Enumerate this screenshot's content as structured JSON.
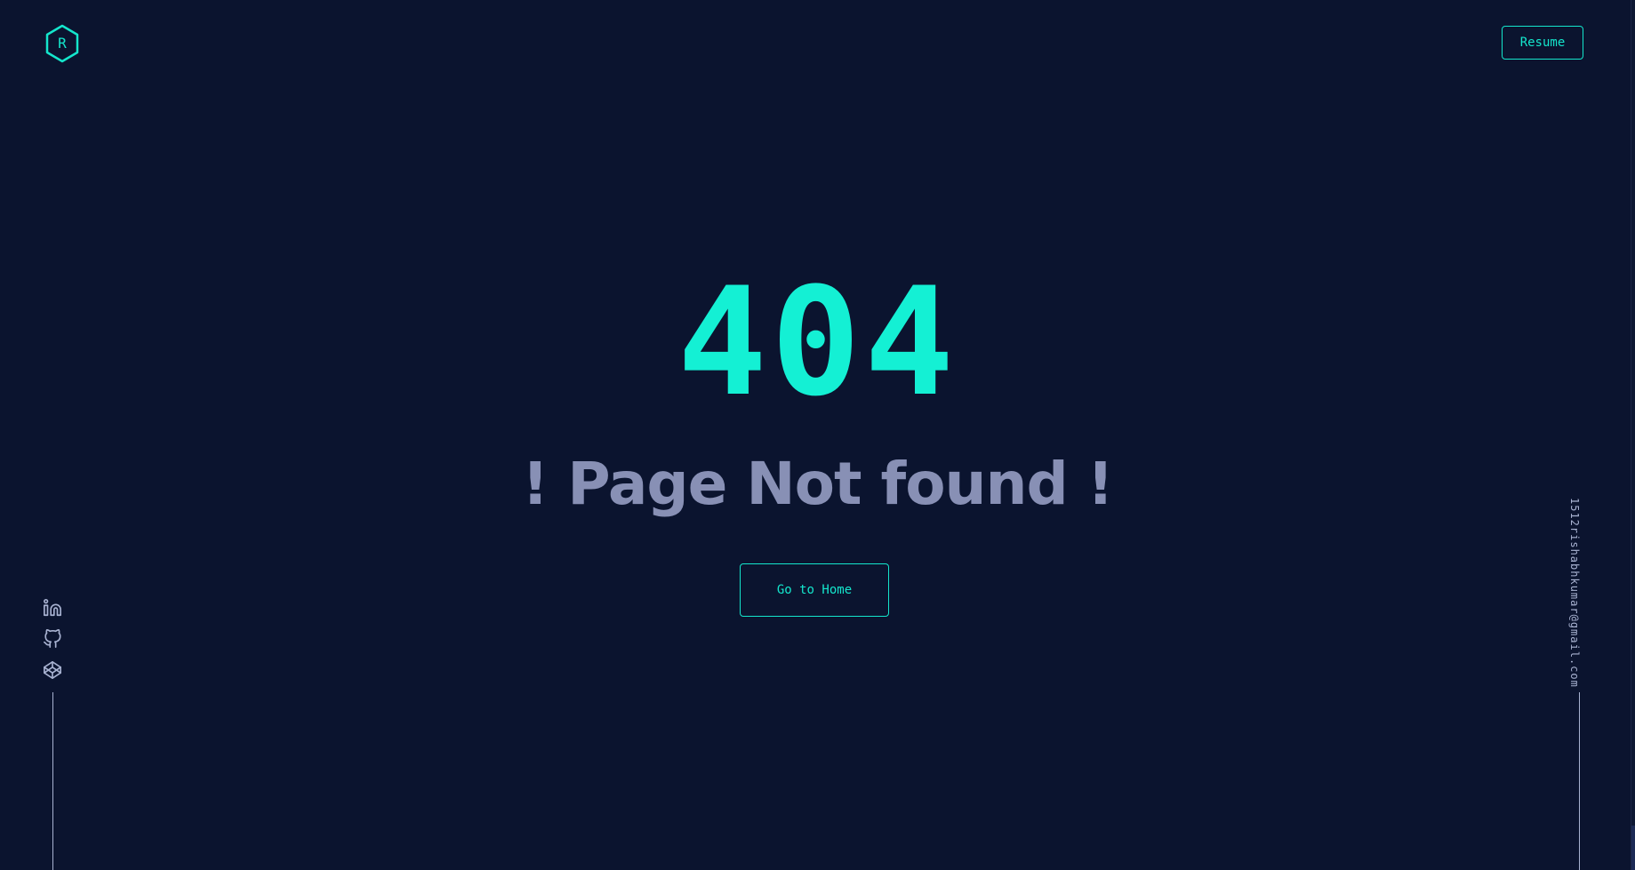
{
  "colors": {
    "background": "#0b142f",
    "accent": "#14e6cc",
    "muted_text": "#8890b5",
    "light_text": "#a8b2d1"
  },
  "header": {
    "logo_letter": "R",
    "logo_icon": "hexagon-logo-icon",
    "resume_label": "Resume"
  },
  "main": {
    "error_code": "404",
    "message": "! Page Not found !",
    "home_button_label": "Go to Home"
  },
  "social": {
    "icons": [
      "linkedin-icon",
      "github-icon",
      "codepen-icon"
    ]
  },
  "contact": {
    "email": "1512rishabhkumar@gmail.com"
  }
}
